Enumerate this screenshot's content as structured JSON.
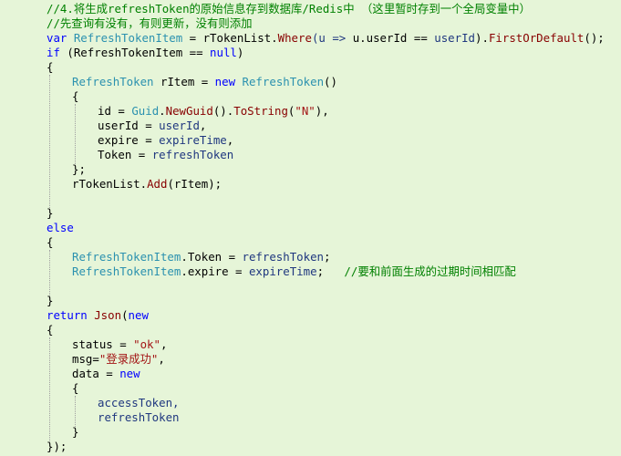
{
  "code": {
    "lines": [
      {
        "indent": 0,
        "tokens": [
          {
            "t": "//4.将生成refreshToken的原始信息存到数据库/Redis中 （这里暂时存到一个全局变量中）",
            "c": "cm"
          }
        ]
      },
      {
        "indent": 0,
        "tokens": [
          {
            "t": "//先查询有没有，有则更新，没有则添加",
            "c": "cm"
          }
        ]
      },
      {
        "indent": 0,
        "tokens": [
          {
            "t": "var ",
            "c": "kw"
          },
          {
            "t": "RefreshTokenItem",
            "c": "ty"
          },
          {
            "t": " = rTokenList.",
            "c": "pl"
          },
          {
            "t": "Where",
            "c": "mt"
          },
          {
            "t": "(u => ",
            "c": "pm"
          },
          {
            "t": "u.userId == ",
            "c": "pl"
          },
          {
            "t": "userId",
            "c": "pm"
          },
          {
            "t": ").",
            "c": "pl"
          },
          {
            "t": "FirstOrDefault",
            "c": "mt"
          },
          {
            "t": "();",
            "c": "pl"
          }
        ]
      },
      {
        "indent": 0,
        "tokens": [
          {
            "t": "if ",
            "c": "kw"
          },
          {
            "t": "(RefreshTokenItem == ",
            "c": "pl"
          },
          {
            "t": "null",
            "c": "kw"
          },
          {
            "t": ")",
            "c": "pl"
          }
        ]
      },
      {
        "indent": 0,
        "tokens": [
          {
            "t": "{",
            "c": "pl"
          }
        ]
      },
      {
        "indent": 1,
        "tokens": [
          {
            "t": "RefreshToken",
            "c": "ty"
          },
          {
            "t": " rItem = ",
            "c": "pl"
          },
          {
            "t": "new ",
            "c": "kw"
          },
          {
            "t": "RefreshToken",
            "c": "ty"
          },
          {
            "t": "()",
            "c": "pl"
          }
        ]
      },
      {
        "indent": 1,
        "tokens": [
          {
            "t": "{",
            "c": "pl"
          }
        ]
      },
      {
        "indent": 2,
        "tokens": [
          {
            "t": "id = ",
            "c": "pl"
          },
          {
            "t": "Guid",
            "c": "ty"
          },
          {
            "t": ".",
            "c": "pl"
          },
          {
            "t": "NewGuid",
            "c": "mt"
          },
          {
            "t": "().",
            "c": "pl"
          },
          {
            "t": "ToString",
            "c": "mt"
          },
          {
            "t": "(",
            "c": "pl"
          },
          {
            "t": "\"N\"",
            "c": "str"
          },
          {
            "t": "),",
            "c": "pl"
          }
        ]
      },
      {
        "indent": 2,
        "tokens": [
          {
            "t": "userId = ",
            "c": "pl"
          },
          {
            "t": "userId",
            "c": "pm"
          },
          {
            "t": ",",
            "c": "pl"
          }
        ]
      },
      {
        "indent": 2,
        "tokens": [
          {
            "t": "expire = ",
            "c": "pl"
          },
          {
            "t": "expireTime",
            "c": "pm"
          },
          {
            "t": ",",
            "c": "pl"
          }
        ]
      },
      {
        "indent": 2,
        "tokens": [
          {
            "t": "Token = ",
            "c": "pl"
          },
          {
            "t": "refreshToken",
            "c": "pm"
          }
        ]
      },
      {
        "indent": 1,
        "tokens": [
          {
            "t": "};",
            "c": "pl"
          }
        ]
      },
      {
        "indent": 1,
        "tokens": [
          {
            "t": "rTokenList.",
            "c": "pl"
          },
          {
            "t": "Add",
            "c": "mt"
          },
          {
            "t": "(rItem);",
            "c": "pl"
          }
        ]
      },
      {
        "indent": 0,
        "tokens": []
      },
      {
        "indent": 0,
        "tokens": [
          {
            "t": "}",
            "c": "pl"
          }
        ]
      },
      {
        "indent": 0,
        "tokens": [
          {
            "t": "else",
            "c": "kw"
          }
        ]
      },
      {
        "indent": 0,
        "tokens": [
          {
            "t": "{",
            "c": "pl"
          }
        ]
      },
      {
        "indent": 1,
        "tokens": [
          {
            "t": "RefreshTokenItem",
            "c": "ty"
          },
          {
            "t": ".Token = ",
            "c": "pl"
          },
          {
            "t": "refreshToken",
            "c": "pm"
          },
          {
            "t": ";",
            "c": "pl"
          }
        ]
      },
      {
        "indent": 1,
        "tokens": [
          {
            "t": "RefreshTokenItem",
            "c": "ty"
          },
          {
            "t": ".expire = ",
            "c": "pl"
          },
          {
            "t": "expireTime",
            "c": "pm"
          },
          {
            "t": ";   ",
            "c": "pl"
          },
          {
            "t": "//要和前面生成的过期时间相匹配",
            "c": "cm"
          }
        ]
      },
      {
        "indent": 0,
        "tokens": []
      },
      {
        "indent": 0,
        "tokens": [
          {
            "t": "}",
            "c": "pl"
          }
        ]
      },
      {
        "indent": 0,
        "tokens": [
          {
            "t": "return ",
            "c": "kw"
          },
          {
            "t": "Json",
            "c": "mt"
          },
          {
            "t": "(",
            "c": "pl"
          },
          {
            "t": "new",
            "c": "kw"
          }
        ]
      },
      {
        "indent": 0,
        "tokens": [
          {
            "t": "{",
            "c": "pl"
          }
        ]
      },
      {
        "indent": 1,
        "tokens": [
          {
            "t": "status = ",
            "c": "pl"
          },
          {
            "t": "\"ok\"",
            "c": "str"
          },
          {
            "t": ",",
            "c": "pl"
          }
        ]
      },
      {
        "indent": 1,
        "tokens": [
          {
            "t": "msg=",
            "c": "pl"
          },
          {
            "t": "\"登录成功\"",
            "c": "str"
          },
          {
            "t": ",",
            "c": "pl"
          }
        ]
      },
      {
        "indent": 1,
        "tokens": [
          {
            "t": "data = ",
            "c": "pl"
          },
          {
            "t": "new",
            "c": "kw"
          }
        ]
      },
      {
        "indent": 1,
        "tokens": [
          {
            "t": "{",
            "c": "pl"
          }
        ]
      },
      {
        "indent": 2,
        "tokens": [
          {
            "t": "accessToken,",
            "c": "pm"
          }
        ]
      },
      {
        "indent": 2,
        "tokens": [
          {
            "t": "refreshToken",
            "c": "pm"
          }
        ]
      },
      {
        "indent": 1,
        "tokens": [
          {
            "t": "}",
            "c": "pl"
          }
        ]
      },
      {
        "indent": 0,
        "tokens": [
          {
            "t": "});",
            "c": "pl"
          }
        ]
      }
    ]
  },
  "colors": {
    "background": "#E6F5D8",
    "keyword": "#0000FF",
    "type": "#2B91AF",
    "string": "#A31515",
    "comment": "#008000",
    "method": "#880000",
    "variable": "#1F377F"
  }
}
